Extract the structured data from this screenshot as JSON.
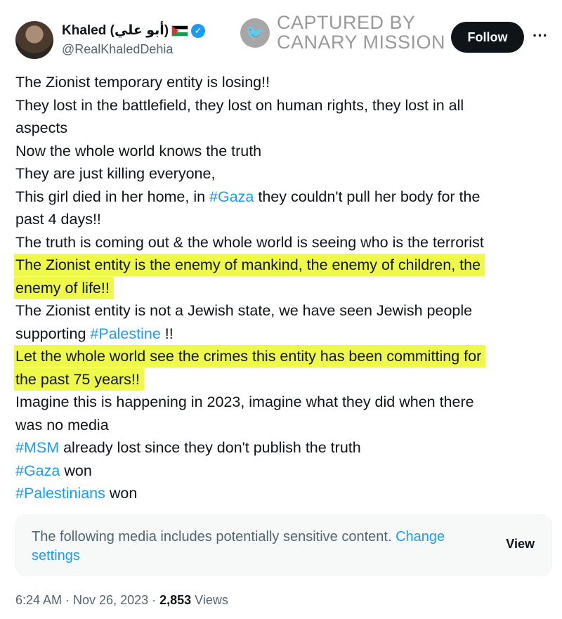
{
  "author": {
    "name": "Khaled (أبو علي)",
    "handle": "@RealKhaledDehia"
  },
  "watermark": {
    "line1": "CAPTURED BY",
    "line2": "CANARY MISSION"
  },
  "follow_label": "Follow",
  "more_label": "···",
  "tweet": {
    "l1": "The Zionist temporary entity is losing!!",
    "l2": "They lost in the battlefield, they lost on human rights, they lost in all",
    "l3": "aspects",
    "l4": "Now the whole world knows the truth",
    "l5": "They are just killing everyone,",
    "l6a": "This girl died in her home, in ",
    "l6tag": "#Gaza",
    "l6b": " they couldn't pull her body for the",
    "l7": "past 4 days!!",
    "l8": "The truth is coming out & the whole world is seeing who is the terrorist",
    "l9": "The Zionist entity is the enemy of mankind, the enemy of children, the",
    "l10": "enemy of life!!",
    "l11": "The Zionist entity is not a Jewish state, we have seen Jewish people",
    "l12a": "supporting ",
    "l12tag": "#Palestine",
    "l12b": " !!",
    "l13": "Let the whole world see the crimes this entity has been committing for",
    "l14": "the past 75 years!!",
    "l15": "Imagine this is happening in 2023, imagine what they did when there",
    "l16": "was no media",
    "l17tag": "#MSM",
    "l17b": " already lost since they don't publish the truth",
    "l18tag": "#Gaza",
    "l18b": " won",
    "l19tag": "#Palestinians",
    "l19b": " won"
  },
  "sensitive": {
    "text": "The following media includes potentially sensitive content. ",
    "link": "Change settings",
    "view": "View"
  },
  "meta": {
    "time": "6:24 AM · Nov 26, 2023 · ",
    "views_count": "2,853",
    "views_label": " Views"
  },
  "colors": {
    "accent": "#1d9bf0",
    "highlight": "#eef94a",
    "text": "#0f1419",
    "secondary": "#536471"
  }
}
